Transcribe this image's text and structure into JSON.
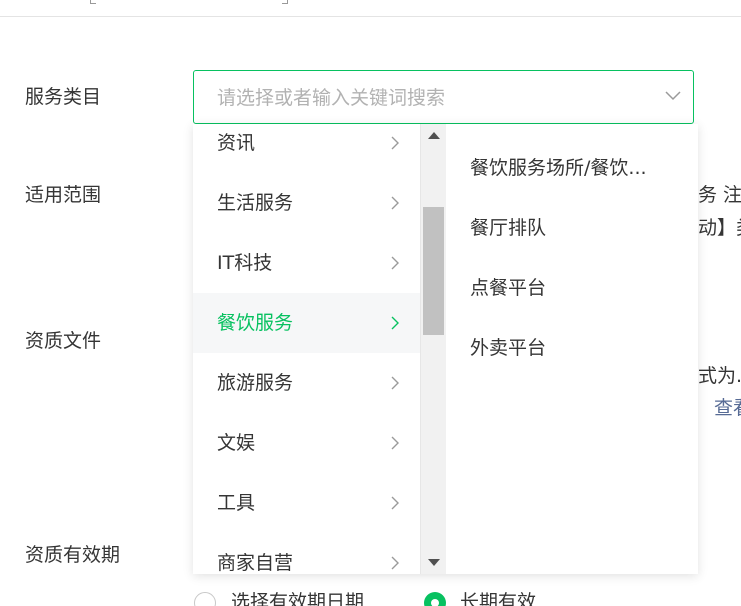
{
  "form": {
    "labels": {
      "service_category": "服务类目",
      "scope": "适用范围",
      "qualification_file": "资质文件",
      "validity": "资质有效期"
    },
    "select": {
      "placeholder": "请选择或者输入关键词搜索",
      "arrow_icon": "chevron-down-icon"
    },
    "background_fragments": {
      "scope_line1": "务 注",
      "scope_line2": "动】类",
      "file_line1": "式为.",
      "file_link": "查看"
    },
    "radios": {
      "pick_date": "选择有效期日期",
      "long_term": "长期有效",
      "selected": "long_term"
    }
  },
  "dropdown": {
    "level1": [
      {
        "label": "资讯",
        "active": false
      },
      {
        "label": "生活服务",
        "active": false
      },
      {
        "label": "IT科技",
        "active": false
      },
      {
        "label": "餐饮服务",
        "active": true
      },
      {
        "label": "旅游服务",
        "active": false
      },
      {
        "label": "文娱",
        "active": false
      },
      {
        "label": "工具",
        "active": false
      },
      {
        "label": "商家自营",
        "active": false
      }
    ],
    "level2": [
      {
        "label": "餐饮服务场所/餐饮..."
      },
      {
        "label": "餐厅排队"
      },
      {
        "label": "点餐平台"
      },
      {
        "label": "外卖平台"
      }
    ],
    "scroll_position": 0.3
  },
  "colors": {
    "accent": "#07c160",
    "link": "#576b95",
    "text": "#353535",
    "placeholder": "#b2b2b2"
  }
}
